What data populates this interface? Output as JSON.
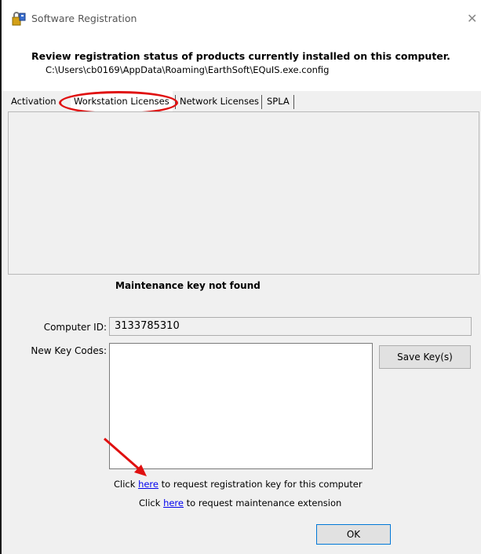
{
  "window": {
    "title": "Software Registration"
  },
  "header": {
    "heading": "Review registration status of products currently installed on this computer.",
    "config_path": "C:\\Users\\cb0169\\AppData\\Roaming\\EarthSoft\\EQuIS.exe.config"
  },
  "tabs": [
    {
      "label": "Activation",
      "selected": false
    },
    {
      "label": "Workstation Licenses",
      "selected": true
    },
    {
      "label": "Network Licenses",
      "selected": false
    },
    {
      "label": "SPLA",
      "selected": false
    }
  ],
  "main": {
    "status_message": "Maintenance key not found",
    "computer_id_label": "Computer ID:",
    "computer_id_value": "3133785310",
    "new_key_codes_label": "New Key Codes:",
    "new_key_codes_value": "",
    "save_button_label": "Save Key(s)"
  },
  "links": {
    "registration": {
      "prefix": "Click ",
      "link_text": "here",
      "suffix": " to request registration key for this computer"
    },
    "maintenance": {
      "prefix": "Click ",
      "link_text": "here",
      "suffix": " to request maintenance extension"
    }
  },
  "footer": {
    "ok_label": "OK"
  },
  "colors": {
    "annotation": "#e01010",
    "link": "#0000ee"
  },
  "icons": {
    "app": "padlock-key-icon",
    "close": "close-icon"
  }
}
